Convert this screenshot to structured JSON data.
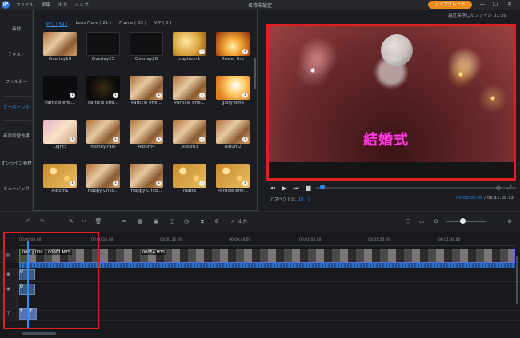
{
  "app": {
    "logo": "iP",
    "title": "名称未設定",
    "menu": [
      "ファイル",
      "編集",
      "出力",
      "ヘルプ"
    ],
    "upgrade_label": "アップグレード",
    "window_controls": [
      "—",
      "☐",
      "✕"
    ],
    "autosave_text": "最近保存したファイル 01:35"
  },
  "sidebar": {
    "items": [
      {
        "label": "素材",
        "active": false
      },
      {
        "label": "テキスト",
        "active": false
      },
      {
        "label": "フィルター",
        "active": false
      },
      {
        "label": "オーバーレイ",
        "active": true
      },
      {
        "label": "画面切替効果",
        "active": false
      },
      {
        "label": "オンライン素材",
        "active": false
      },
      {
        "label": "ミュージック",
        "active": false
      }
    ]
  },
  "media": {
    "tabs": [
      {
        "label": "全て ( 54 )",
        "active": true
      },
      {
        "label": "Lens Flare ( 21 )",
        "active": false
      },
      {
        "label": "Frame ( 33 )",
        "active": false
      },
      {
        "label": "VIP ( 0 )",
        "active": false
      }
    ],
    "tiles": [
      {
        "label": "Overlay10",
        "style": "th-cat",
        "download": false
      },
      {
        "label": "Overlay25",
        "style": "th-frame",
        "download": false
      },
      {
        "label": "Overlay26",
        "style": "th-frame",
        "download": false
      },
      {
        "label": "capture-1",
        "style": "th-gold",
        "download": true
      },
      {
        "label": "flower fire",
        "style": "th-fire",
        "download": true
      },
      {
        "label": "Particle effe...",
        "style": "th-dark",
        "download": true
      },
      {
        "label": "Particle effe...",
        "style": "th-spark",
        "download": true
      },
      {
        "label": "Particle effe...",
        "style": "th-cat",
        "download": true
      },
      {
        "label": "Particle effe...",
        "style": "th-cat",
        "download": true
      },
      {
        "label": "glory time",
        "style": "th-glory",
        "download": true
      },
      {
        "label": "Light5",
        "style": "th-pink",
        "download": true
      },
      {
        "label": "money rain",
        "style": "th-cat",
        "download": true
      },
      {
        "label": "Album4",
        "style": "th-cat",
        "download": true
      },
      {
        "label": "Album3",
        "style": "th-cat",
        "download": true
      },
      {
        "label": "Album2",
        "style": "th-cat",
        "download": true
      },
      {
        "label": "Album1",
        "style": "th-bokeh",
        "download": true
      },
      {
        "label": "Happy Child...",
        "style": "th-cat",
        "download": true
      },
      {
        "label": "Happy Child...",
        "style": "th-cat",
        "download": true
      },
      {
        "label": "matte",
        "style": "th-bokeh",
        "download": true
      },
      {
        "label": "Particle effe...",
        "style": "th-bokeh",
        "download": true
      }
    ]
  },
  "preview": {
    "caption": "結婚式",
    "aspect_label": "アスペクト比",
    "aspect_value": "16 : 9",
    "current_time": "00:00:02.00",
    "total_time": "00:11:08.12",
    "progress": 0.03,
    "controls": [
      "⏮",
      "▶",
      "⏭",
      "■"
    ]
  },
  "toolbar": {
    "export_label": "出力",
    "zoom_level": 0.42
  },
  "timeline": {
    "ruler": [
      "00:00:00.00",
      "00:00:16.00",
      "00:00:32.00",
      "00:00:48.00",
      "00:01:04.00",
      "00:01:20.00",
      "00:01:36.00"
    ],
    "clips": {
      "video_1_label": "00001.MTS",
      "video_2_label": "00054.MTS",
      "prefix_1": "000",
      "prefix_2": "000",
      "overlay_1": "O",
      "overlay_2": "O",
      "text_clip": "T",
      "text_clip_2": "T"
    }
  }
}
